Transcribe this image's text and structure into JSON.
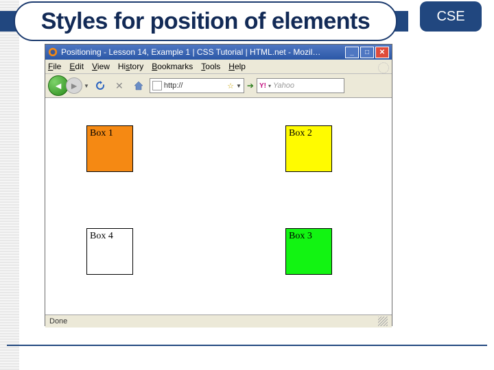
{
  "layout": {
    "title": "Styles for position of elements",
    "badge": "CSE"
  },
  "browser": {
    "window_title": "Positioning - Lesson 14, Example 1 | CSS Tutorial | HTML.net - Mozil…",
    "menus": {
      "file": "File",
      "edit": "Edit",
      "view": "View",
      "history": "History",
      "bookmarks": "Bookmarks",
      "tools": "Tools",
      "help": "Help"
    },
    "url_text": "http://",
    "search_placeholder": "Yahoo",
    "status_text": "Done"
  },
  "boxes": {
    "b1": "Box 1",
    "b2": "Box 2",
    "b3": "Box 3",
    "b4": "Box 4"
  }
}
